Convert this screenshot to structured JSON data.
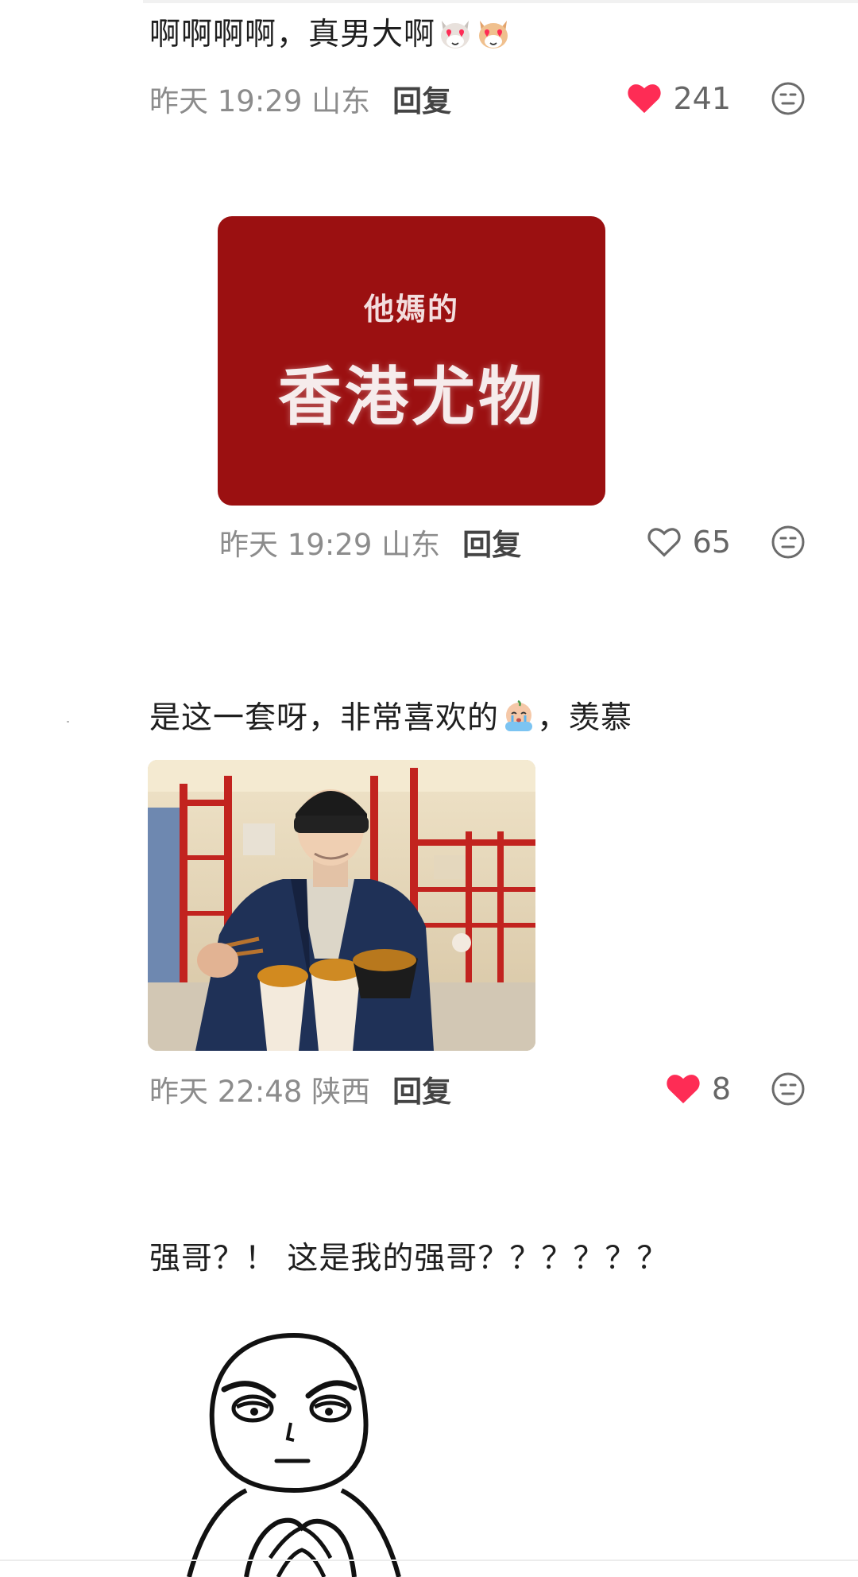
{
  "comments": [
    {
      "text": "啊啊啊啊，真男大啊",
      "emoji": "heart-eyes-cat-emoji",
      "time": "昨天 19:29 山东",
      "reply_label": "回复",
      "likes": "241",
      "liked": true
    },
    {
      "card": {
        "small": "他媽的",
        "big": "香港尤物",
        "background": "#9b1011"
      },
      "time": "昨天 19:29 山东",
      "reply_label": "回复",
      "likes": "65",
      "liked": false
    },
    {
      "text_before": "是这一套呀，非常喜欢的",
      "emoji": "crying-emoji",
      "text_after": "，羡慕",
      "image": "photo-man-eating-noodles",
      "time": "昨天 22:48 陕西",
      "reply_label": "回复",
      "likes": "8",
      "liked": true
    },
    {
      "text": "强哥？！ 这是我的强哥？？？？？？",
      "image": "meme-face-sticker"
    }
  ],
  "colors": {
    "like_red": "#fe2c55",
    "meta_gray": "#8c8c8c",
    "text": "#1f1f1f"
  }
}
